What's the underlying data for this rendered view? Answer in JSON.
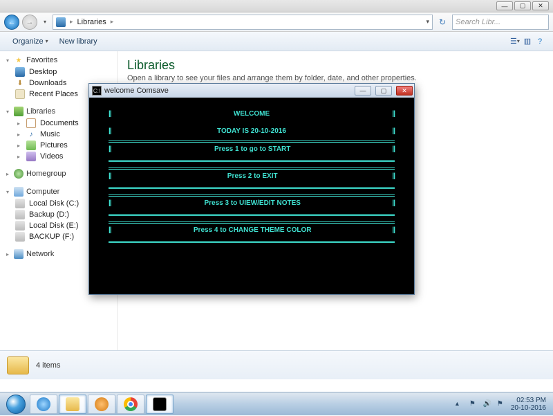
{
  "win_controls": {
    "min": "—",
    "max": "▢",
    "close": "✕"
  },
  "breadcrumb": {
    "seg1": "▸",
    "seg2": "Libraries",
    "seg3": "▸"
  },
  "search": {
    "placeholder": "Search Libr..."
  },
  "toolbar": {
    "organize": "Organize",
    "newlib": "New library"
  },
  "sidebar": {
    "favorites": "Favorites",
    "desktop": "Desktop",
    "downloads": "Downloads",
    "recent": "Recent Places",
    "libraries": "Libraries",
    "documents": "Documents",
    "music": "Music",
    "pictures": "Pictures",
    "videos": "Videos",
    "homegroup": "Homegroup",
    "computer": "Computer",
    "disk_c": "Local Disk (C:)",
    "disk_d": "Backup (D:)",
    "disk_e": "Local Disk  (E:)",
    "disk_f": "BACKUP (F:)",
    "network": "Network"
  },
  "content": {
    "title": "Libraries",
    "subtitle": "Open a library to see your files and arrange them by folder, date, and other properties."
  },
  "status": {
    "items": "4 items"
  },
  "tray": {
    "time": "02:53 PM",
    "date": "20-10-2016"
  },
  "cmd": {
    "title": "welcome Comsave",
    "welcome": "WELCOME",
    "today": "TODAY IS 20-10-2016",
    "m1": "Press 1 to go to START",
    "m2": "Press 2 to EXIT",
    "m3": "Press 3 to UIEW/EDIT NOTES",
    "m4": "Press 4 to CHANGE THEME COLOR",
    "bar": "||"
  }
}
